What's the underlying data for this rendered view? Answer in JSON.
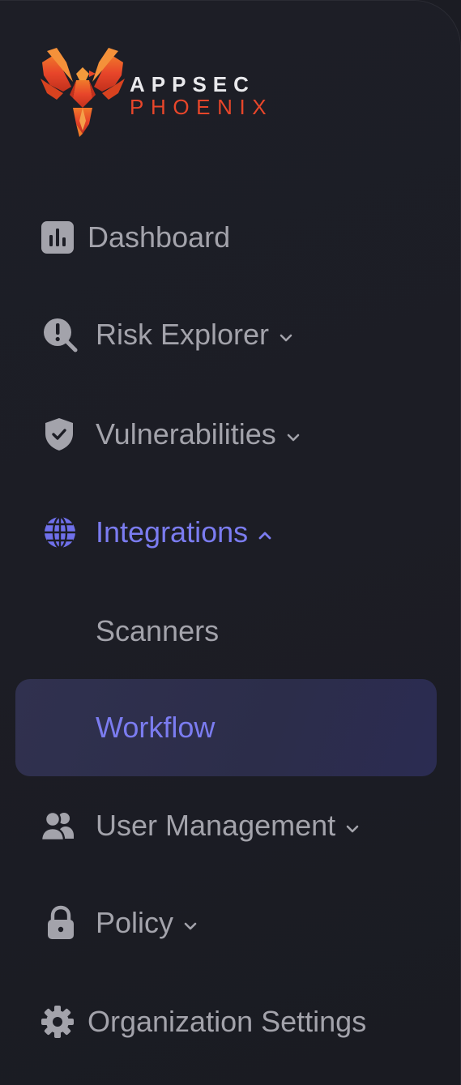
{
  "brand": {
    "line1": "APPSEC",
    "line2": "PHOENIX",
    "logo_icon": "phoenix-logo-icon",
    "primary_color": "#e8462a",
    "text_color": "#e9e9ec"
  },
  "nav": {
    "dashboard": {
      "label": "Dashboard",
      "icon": "bar-chart-icon"
    },
    "risk_explorer": {
      "label": "Risk Explorer",
      "icon": "risk-search-icon"
    },
    "vulnerabilities": {
      "label": "Vulnerabilities",
      "icon": "shield-check-icon"
    },
    "integrations": {
      "label": "Integrations",
      "icon": "globe-icon",
      "expanded": true
    },
    "integrations_sub": [
      {
        "label": "Scanners",
        "selected": false
      },
      {
        "label": "Workflow",
        "selected": true
      }
    ],
    "user_management": {
      "label": "User Management",
      "icon": "users-icon"
    },
    "policy": {
      "label": "Policy",
      "icon": "lock-icon"
    },
    "org_settings": {
      "label": "Organization Settings",
      "icon": "gear-icon"
    }
  },
  "colors": {
    "background": "#1b1c23",
    "text_muted": "#a3a3ab",
    "accent": "#7b7cf0",
    "selected_bg": "#2e2f4e"
  }
}
